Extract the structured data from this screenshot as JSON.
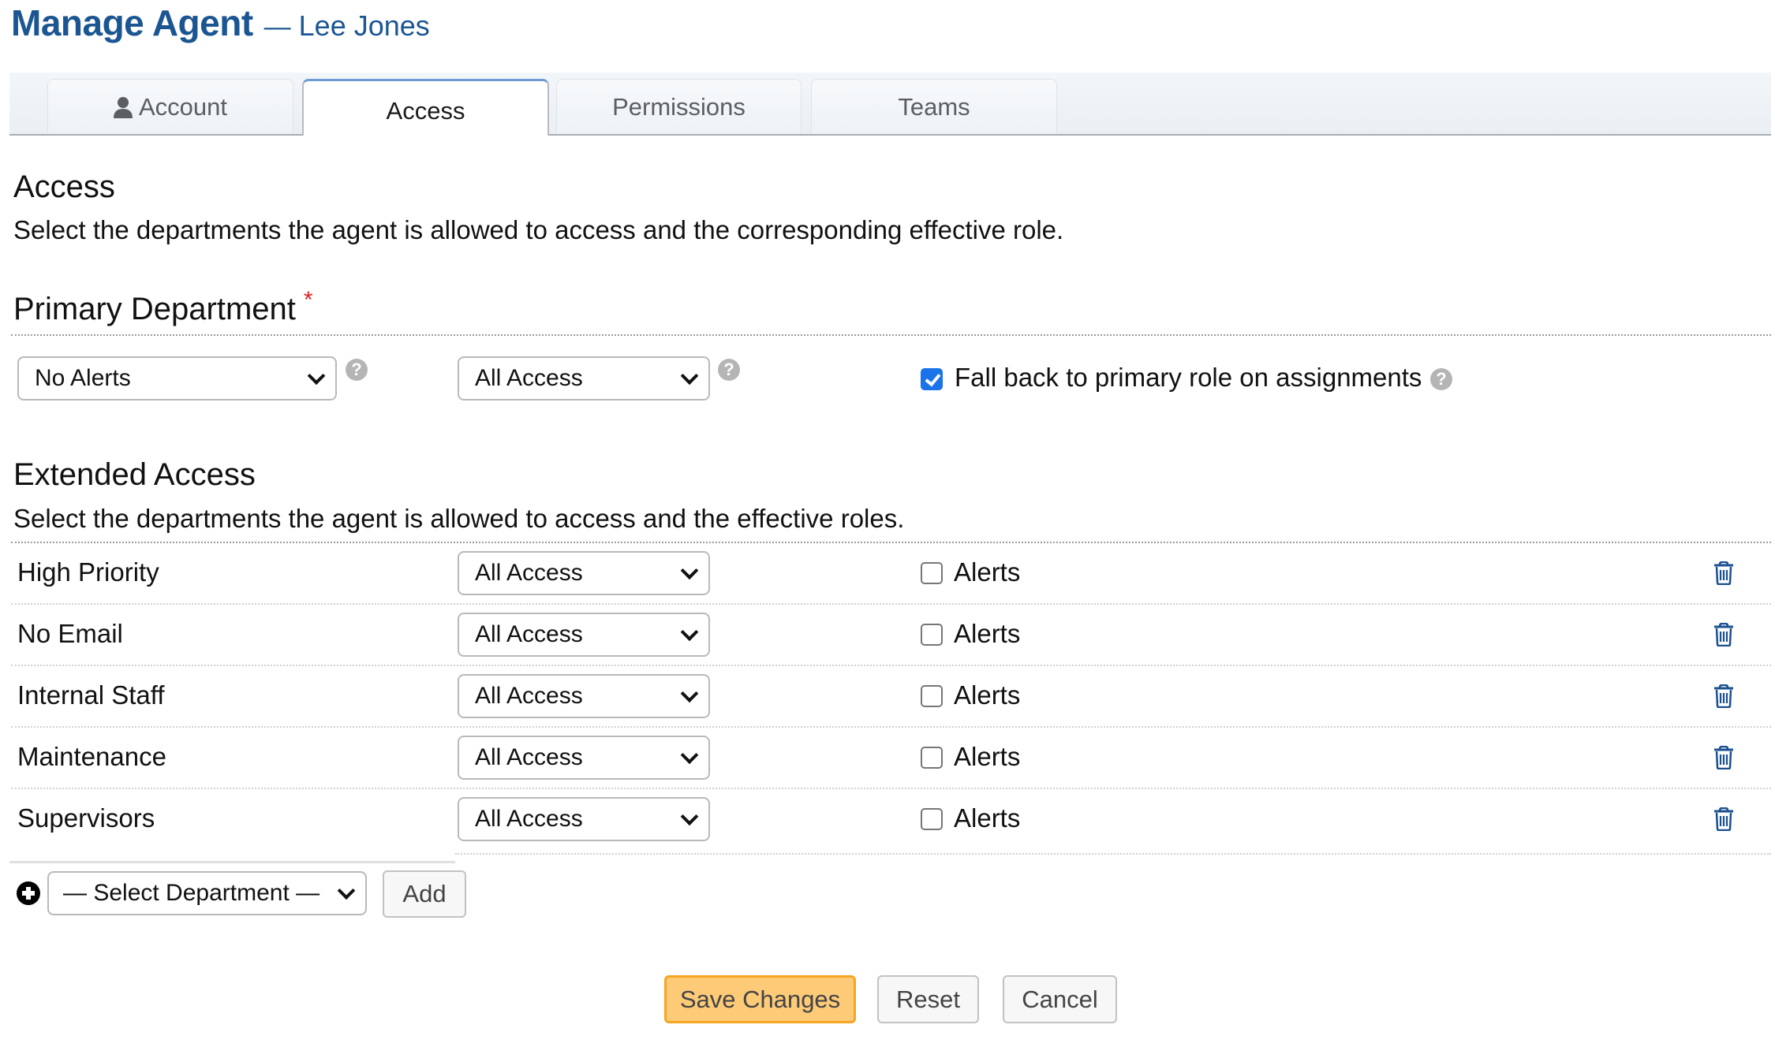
{
  "header": {
    "title": "Manage Agent",
    "separator": "—",
    "agent_name": "Lee Jones"
  },
  "tabs": [
    {
      "label": "Account",
      "icon": "user-icon",
      "active": false
    },
    {
      "label": "Access",
      "active": true
    },
    {
      "label": "Permissions",
      "active": false
    },
    {
      "label": "Teams",
      "active": false
    }
  ],
  "access": {
    "heading": "Access",
    "description": "Select the departments the agent is allowed to access and the corresponding effective role."
  },
  "primary": {
    "heading": "Primary Department",
    "required_marker": "*",
    "department_value": "No Alerts",
    "role_value": "All Access",
    "help_glyph": "?",
    "fallback_label": "Fall back to primary role on assignments",
    "fallback_checked": true
  },
  "extended": {
    "heading": "Extended Access",
    "description": "Select the departments the agent is allowed to access and the effective roles.",
    "rows": [
      {
        "department": "High Priority",
        "role": "All Access",
        "alerts_label": "Alerts",
        "alerts_checked": false
      },
      {
        "department": "No Email",
        "role": "All Access",
        "alerts_label": "Alerts",
        "alerts_checked": false
      },
      {
        "department": "Internal Staff",
        "role": "All Access",
        "alerts_label": "Alerts",
        "alerts_checked": false
      },
      {
        "department": "Maintenance",
        "role": "All Access",
        "alerts_label": "Alerts",
        "alerts_checked": false
      },
      {
        "department": "Supervisors",
        "role": "All Access",
        "alerts_label": "Alerts",
        "alerts_checked": false
      }
    ],
    "add_select_value": "— Select Department —",
    "add_button": "Add"
  },
  "actions": {
    "save": "Save Changes",
    "reset": "Reset",
    "cancel": "Cancel"
  },
  "colors": {
    "title": "#1b5692",
    "accent_checkbox": "#1a73e8",
    "primary_button_bg": "#fdca78",
    "primary_button_border": "#f5a623",
    "trash_icon": "#1b4f8f",
    "required": "#e02020"
  }
}
